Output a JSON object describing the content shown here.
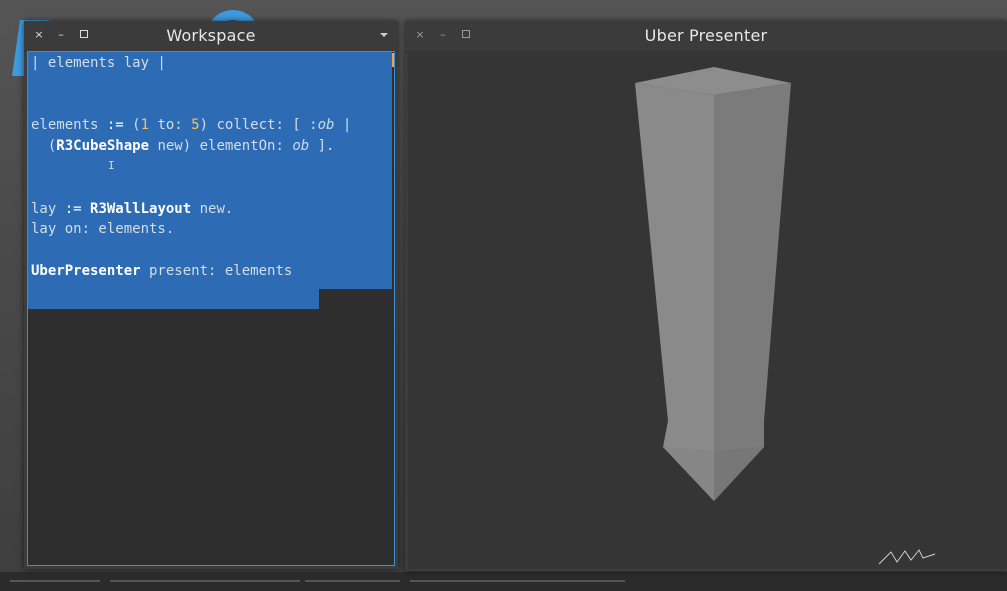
{
  "workspace": {
    "title": "Workspace",
    "controls": {
      "close": "×",
      "minimize": "–"
    },
    "code_lines": [
      [
        {
          "t": "| elements lay |",
          "c": ""
        }
      ],
      [
        {
          "t": "",
          "c": ""
        }
      ],
      [
        {
          "t": "",
          "c": ""
        }
      ],
      [
        {
          "t": "elements ",
          "c": ""
        },
        {
          "t": ":=",
          "c": "op"
        },
        {
          "t": " (",
          "c": ""
        },
        {
          "t": "1",
          "c": "num"
        },
        {
          "t": " to: ",
          "c": ""
        },
        {
          "t": "5",
          "c": "num"
        },
        {
          "t": ") collect: [ :",
          "c": ""
        },
        {
          "t": "ob",
          "c": "it"
        },
        {
          "t": " |",
          "c": ""
        }
      ],
      [
        {
          "t": "  (",
          "c": ""
        },
        {
          "t": "R3CubeShape",
          "c": "kw"
        },
        {
          "t": " new) elementOn: ",
          "c": ""
        },
        {
          "t": "ob",
          "c": "it"
        },
        {
          "t": " ].",
          "c": ""
        }
      ],
      [
        {
          "t": "",
          "c": ""
        }
      ],
      [
        {
          "t": "",
          "c": ""
        }
      ],
      [
        {
          "t": "lay ",
          "c": ""
        },
        {
          "t": ":=",
          "c": "op"
        },
        {
          "t": " ",
          "c": ""
        },
        {
          "t": "R3WallLayout",
          "c": "kw"
        },
        {
          "t": " new.",
          "c": ""
        }
      ],
      [
        {
          "t": "lay on: elements.",
          "c": ""
        }
      ],
      [
        {
          "t": "",
          "c": ""
        }
      ],
      [
        {
          "t": "UberPresenter",
          "c": "kw"
        },
        {
          "t": " present: elements",
          "c": ""
        }
      ]
    ]
  },
  "presenter": {
    "title": "Uber Presenter",
    "controls": {
      "close": "×",
      "minimize": "–"
    }
  },
  "colors": {
    "selection": "#2d6cb4",
    "accent": "#3a8fd4",
    "number": "#f3c55b",
    "box_light": "#8a8a8a",
    "box_dark": "#7b7b7b",
    "viewport_bg": "#353535"
  }
}
